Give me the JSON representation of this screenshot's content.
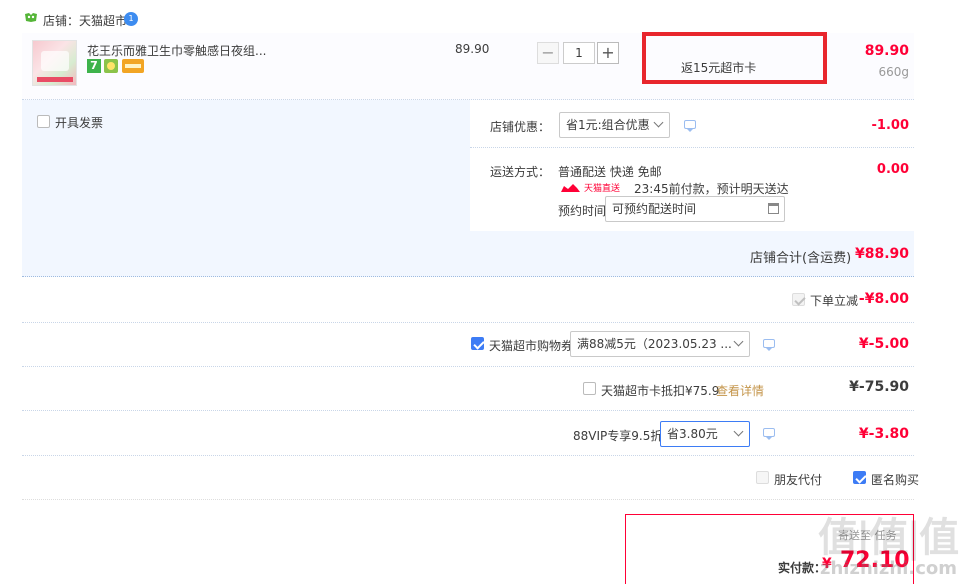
{
  "shop": {
    "label": "店铺：天猫超市",
    "badge": "1"
  },
  "item": {
    "title": "花王乐而雅卫生巾零触感日夜组...",
    "unit_price": "89.90",
    "quantity": "1",
    "minus": "−",
    "plus": "+",
    "promo": "返15元超市卡",
    "total": "89.90",
    "weight": "660g"
  },
  "invoice": {
    "label": "开具发票"
  },
  "shop_discount": {
    "label": "店铺优惠：",
    "value": "省1元:组合优惠",
    "amount": "-1.00"
  },
  "shipping": {
    "label": "运送方式：",
    "method": "普通配送 快递 免邮",
    "tag": "天猫直送",
    "note": "23:45前付款，预计明天送达",
    "reserve_label": "预约时间",
    "reserve_placeholder": "可预约配送时间",
    "amount": "0.00"
  },
  "shop_total": {
    "label": "店铺合计(含运费)",
    "amount": "¥88.90"
  },
  "instant_discount": {
    "label": "下单立减",
    "amount": "-¥8.00"
  },
  "coupon": {
    "label": "天猫超市购物券",
    "value": "满88减5元（2023.05.23 ...",
    "amount": "¥-5.00"
  },
  "card": {
    "label": "天猫超市卡抵扣¥75.9",
    "link": "查看详情",
    "amount": "¥-75.90"
  },
  "vip": {
    "label": "88VIP专享9.5折",
    "value": "省3.80元",
    "amount": "¥-3.80"
  },
  "options": {
    "friend_pay": "朋友代付",
    "anonymous": "匿名购买"
  },
  "summary": {
    "top_text": "寄送至 任务",
    "pay_label": "实付款：",
    "currency": "¥",
    "amount": "72.10"
  },
  "watermark": {
    "logo": "值|值|值",
    "url": "zhizhizhi.com"
  },
  "colors": {
    "accent": "#ff0036",
    "blue": "#3d7cf5",
    "highlight_box": "#e8262d"
  }
}
